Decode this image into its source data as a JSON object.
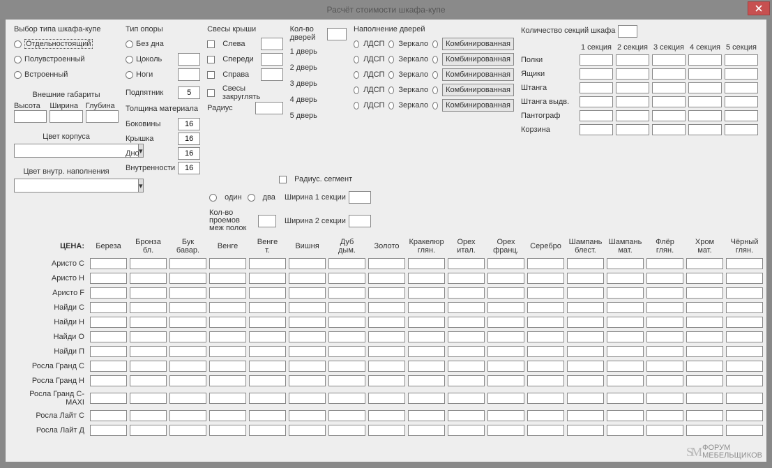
{
  "window": {
    "title": "Расчёт стоимости шкафа-купе"
  },
  "type_group": {
    "label": "Выбор типа шкафа-купе",
    "options": [
      "Отдельностоящий",
      "Полувстроенный",
      "Встроенный"
    ]
  },
  "dims": {
    "label": "Внешние габариты",
    "height": "Высота",
    "width": "Ширина",
    "depth": "Глубина"
  },
  "body_color": {
    "label": "Цвет корпуса"
  },
  "inner_color": {
    "label": "Цвет внутр. наполнения"
  },
  "support": {
    "label": "Тип опоры",
    "options": [
      "Без дна",
      "Цоколь",
      "Ноги"
    ],
    "heel_label": "Подпятник",
    "heel_val": "5",
    "thick_label": "Толщина материала",
    "rows": [
      {
        "l": "Боковины",
        "v": "16"
      },
      {
        "l": "Крышка",
        "v": "16"
      },
      {
        "l": "Дно",
        "v": "16"
      },
      {
        "l": "Внутренности",
        "v": "16"
      }
    ]
  },
  "roof": {
    "label": "Свесы крыши",
    "options": [
      "Слева",
      "Спереди",
      "Справа"
    ],
    "round_label": "Свесы закруглять",
    "radius_label": "Радиус",
    "radius_segment": "Радиус. сегмент",
    "one": "один",
    "two": "два",
    "proemy_label": "Кол-во проемов меж полок",
    "w1": "Ширина 1 секции",
    "w2": "Ширина 2 секции"
  },
  "doors": {
    "count_label": "Кол-во дверей",
    "fill_label": "Наполнение дверей",
    "rows": [
      "1 дверь",
      "2 дверь",
      "3 дверь",
      "4 дверь",
      "5 дверь"
    ],
    "ldsp": "ЛДСП",
    "mirror": "Зеркало",
    "combo_btn": "Комбинированная"
  },
  "sections": {
    "label": "Количество секций шкафа",
    "cols": [
      "1 секция",
      "2 секция",
      "3 секция",
      "4 секция",
      "5 секция"
    ],
    "rows": [
      "Полки",
      "Ящики",
      "Штанга",
      "Штанга выдв.",
      "Пантограф",
      "Корзина"
    ]
  },
  "price": {
    "title": "ЦЕНА:",
    "cols": [
      "Береза",
      "Бронза бл.",
      "Бук бавар.",
      "Венге",
      "Венге т.",
      "Вишня",
      "Дуб дым.",
      "Золото",
      "Кракелюр глян.",
      "Орех итал.",
      "Орех франц.",
      "Серебро",
      "Шампань блест.",
      "Шампань мат.",
      "Флёр глян.",
      "Хром мат.",
      "Чёрный глян."
    ],
    "rows": [
      "Аристо С",
      "Аристо Н",
      "Аристо F",
      "Найди С",
      "Найди Н",
      "Найди О",
      "Найди П",
      "Росла Гранд С",
      "Росла Гранд Н",
      "Росла Гранд С-MAXI",
      "Росла Лайт С",
      "Росла Лайт Д"
    ]
  },
  "watermark": {
    "l1": "ФОРУМ",
    "l2": "МЕБЕЛЬЩИКОВ",
    "sm": "SM"
  }
}
